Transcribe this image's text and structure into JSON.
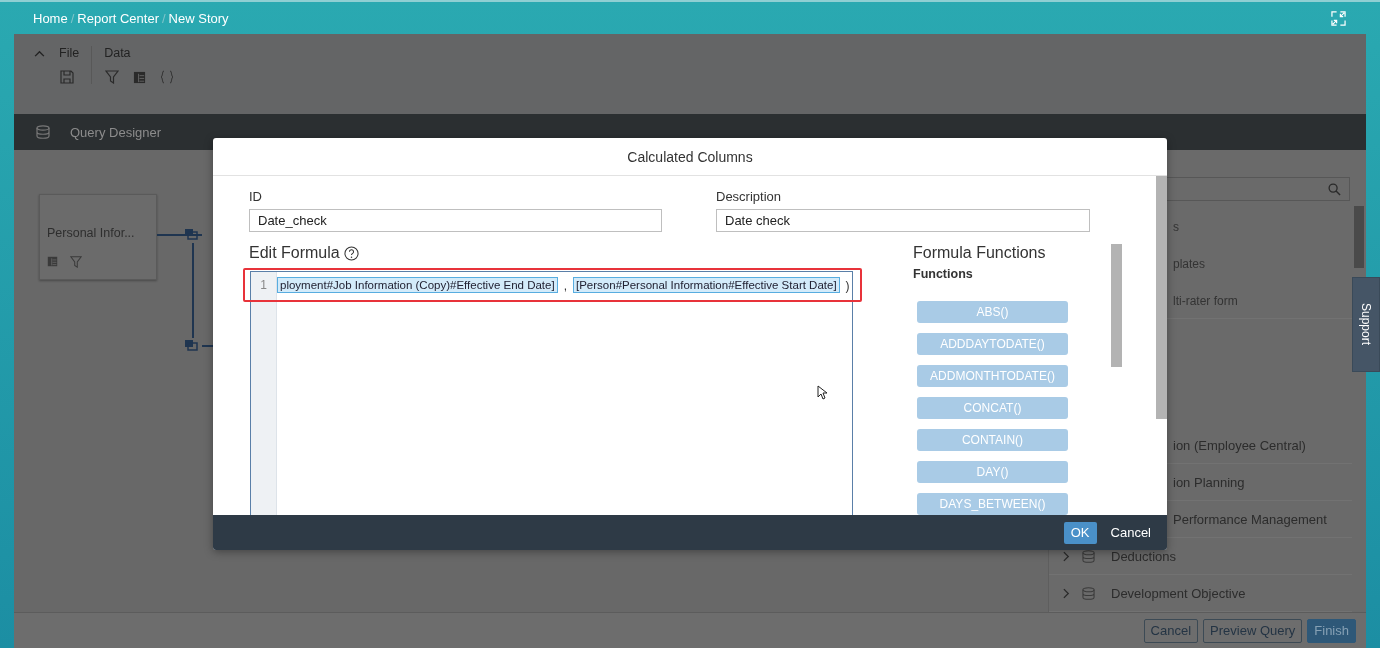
{
  "breadcrumb": [
    {
      "label": "Home"
    },
    {
      "separator": "/",
      "label": "Report Center"
    },
    {
      "separator": "/",
      "label": "New Story"
    }
  ],
  "toolbar": {
    "groups": [
      {
        "label": "File"
      },
      {
        "label": "Data"
      }
    ]
  },
  "query_designer": {
    "title": "Query Designer"
  },
  "canvas": {
    "node": {
      "label": "Personal Infor..."
    }
  },
  "right_panel": {
    "upper_items": [
      {
        "label": "s"
      },
      {
        "label": "plates"
      },
      {
        "label": "lti-rater form"
      }
    ],
    "lower_items": [
      {
        "label": "ion (Employee Central)",
        "kind": "clipped"
      },
      {
        "label": "ion Planning",
        "kind": "clipped"
      },
      {
        "label": "Performance Management",
        "kind": "clipped"
      },
      {
        "label": "Deductions",
        "kind": "full"
      },
      {
        "label": "Development Objective",
        "kind": "full"
      }
    ]
  },
  "bottom_buttons": [
    {
      "label": "Cancel",
      "kind": "default"
    },
    {
      "label": "Preview Query",
      "kind": "default"
    },
    {
      "label": "Finish",
      "kind": "primary"
    }
  ],
  "support_tab": {
    "label": "Support"
  },
  "dialog": {
    "title": "Calculated Columns",
    "id_field": {
      "label": "ID",
      "value": "Date_check"
    },
    "description_field": {
      "label": "Description",
      "value": "Date check"
    },
    "formula": {
      "label": "Edit Formula",
      "line_number": "1",
      "tokens": [
        {
          "kind": "field",
          "text": "ployment#Job Information (Copy)#Effective End Date]"
        },
        {
          "kind": "plain",
          "text": ","
        },
        {
          "kind": "field",
          "text": "[Person#Personal Information#Effective Start Date]"
        },
        {
          "kind": "plain",
          "text": ")"
        }
      ]
    },
    "functions": {
      "title": "Formula Functions",
      "subtitle": "Functions",
      "items": [
        "ABS()",
        "ADDDAYTODATE()",
        "ADDMONTHTODATE()",
        "CONCAT()",
        "CONTAIN()",
        "DAY()",
        "DAYS_BETWEEN()"
      ]
    },
    "buttons": [
      {
        "label": "OK",
        "kind": "primary"
      },
      {
        "label": "Cancel",
        "kind": "default"
      }
    ]
  }
}
